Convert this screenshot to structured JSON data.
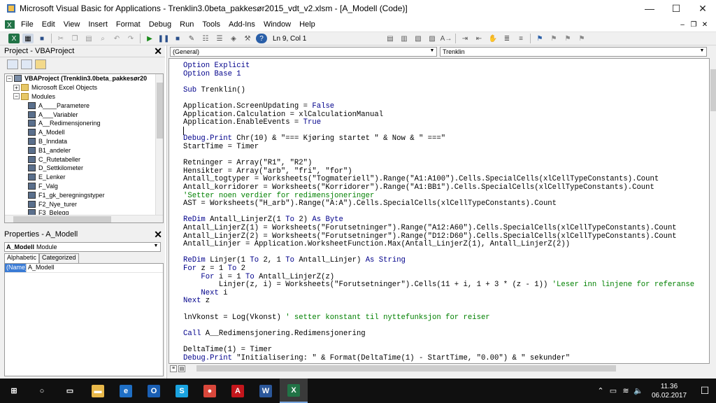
{
  "window": {
    "title": "Microsoft Visual Basic for Applications - Trenklin3.0beta_pakkesør2015_vdt_v2.xlsm - [A_Modell (Code)]",
    "minimize": "—",
    "maximize": "☐",
    "close": "✕"
  },
  "menu": [
    "File",
    "Edit",
    "View",
    "Insert",
    "Format",
    "Debug",
    "Run",
    "Tools",
    "Add-Ins",
    "Window",
    "Help"
  ],
  "mdi": [
    "–",
    "❐",
    "✕"
  ],
  "toolbar": {
    "position": "Ln 9, Col 1"
  },
  "project": {
    "title": "Project - VBAProject",
    "close": "✕",
    "tree": [
      {
        "label": "VBAProject (Trenklin3.0beta_pakkesør20",
        "level": 0,
        "icon": "proj",
        "exp": "−",
        "bold": true
      },
      {
        "label": "Microsoft Excel Objects",
        "level": 1,
        "icon": "folder",
        "exp": "+"
      },
      {
        "label": "Modules",
        "level": 1,
        "icon": "folder",
        "exp": "−"
      },
      {
        "label": "A____Parametere",
        "level": 2,
        "icon": "module"
      },
      {
        "label": "A___Variabler",
        "level": 2,
        "icon": "module"
      },
      {
        "label": "A__Redimensjonering",
        "level": 2,
        "icon": "module"
      },
      {
        "label": "A_Modell",
        "level": 2,
        "icon": "module"
      },
      {
        "label": "B_Inndata",
        "level": 2,
        "icon": "module"
      },
      {
        "label": "B1_andeler",
        "level": 2,
        "icon": "module"
      },
      {
        "label": "C_Rutetabeller",
        "level": 2,
        "icon": "module"
      },
      {
        "label": "D_Settkilometer",
        "level": 2,
        "icon": "module"
      },
      {
        "label": "E_Lenker",
        "level": 2,
        "icon": "module"
      },
      {
        "label": "F_Valg",
        "level": 2,
        "icon": "module"
      },
      {
        "label": "F1_gk_beregningstyper",
        "level": 2,
        "icon": "module"
      },
      {
        "label": "F2_Nye_turer",
        "level": 2,
        "icon": "module"
      },
      {
        "label": "F3_Belegg",
        "level": 2,
        "icon": "module"
      }
    ]
  },
  "properties": {
    "title": "Properties - A_Modell",
    "close": "✕",
    "object_name": "A_Modell",
    "object_type": "Module",
    "tabs": [
      "Alphabetic",
      "Categorized"
    ],
    "rows": [
      {
        "name": "(Name)",
        "value": "A_Modell"
      }
    ]
  },
  "code": {
    "object_combo": "(General)",
    "proc_combo": "Trenklin",
    "lines": [
      [
        [
          "kw",
          "Option Explicit"
        ]
      ],
      [
        [
          "kw",
          "Option Base 1"
        ]
      ],
      [],
      [
        [
          "kw",
          "Sub "
        ],
        [
          "tx",
          "Trenklin()"
        ]
      ],
      [],
      [
        [
          "tx",
          "Application.ScreenUpdating = "
        ],
        [
          "kw",
          "False"
        ]
      ],
      [
        [
          "tx",
          "Application.Calculation = xlCalculationManual"
        ]
      ],
      [
        [
          "tx",
          "Application.EnableEvents = "
        ],
        [
          "kw",
          "True"
        ]
      ],
      [],
      [
        [
          "kw",
          "Debug.Print "
        ],
        [
          "tx",
          "Chr(10) & \"=== Kjøring startet \" & Now & \" ===\""
        ]
      ],
      [
        [
          "tx",
          "StartTime = Timer"
        ]
      ],
      [],
      [
        [
          "tx",
          "Retninger = Array(\"R1\", \"R2\")"
        ]
      ],
      [
        [
          "tx",
          "Hensikter = Array(\"arb\", \"fri\", \"for\")"
        ]
      ],
      [
        [
          "tx",
          "Antall_togtyper = Worksheets(\"Togmateriell\").Range(\"A1:A100\").Cells.SpecialCells(xlCellTypeConstants).Count"
        ]
      ],
      [
        [
          "tx",
          "Antall_korridorer = Worksheets(\"Korridorer\").Range(\"A1:BB1\").Cells.SpecialCells(xlCellTypeConstants).Count"
        ]
      ],
      [
        [
          "cm",
          "'Setter noen verdier for redimensjoneringer"
        ]
      ],
      [
        [
          "tx",
          "AST = Worksheets(\"H_arb\").Range(\"A:A\").Cells.SpecialCells(xlCellTypeConstants).Count"
        ]
      ],
      [],
      [
        [
          "kw",
          "ReDim "
        ],
        [
          "tx",
          "Antall_LinjerZ(1 "
        ],
        [
          "kw",
          "To "
        ],
        [
          "tx",
          "2) "
        ],
        [
          "kw",
          "As Byte"
        ]
      ],
      [
        [
          "tx",
          "Antall_LinjerZ(1) = Worksheets(\"Forutsetninger\").Range(\"A12:A60\").Cells.SpecialCells(xlCellTypeConstants).Count"
        ]
      ],
      [
        [
          "tx",
          "Antall_LinjerZ(2) = Worksheets(\"Forutsetninger\").Range(\"D12:D60\").Cells.SpecialCells(xlCellTypeConstants).Count"
        ]
      ],
      [
        [
          "tx",
          "Antall_Linjer = Application.WorksheetFunction.Max(Antall_LinjerZ(1), Antall_LinjerZ(2))"
        ]
      ],
      [],
      [
        [
          "kw",
          "ReDim "
        ],
        [
          "tx",
          "Linjer(1 "
        ],
        [
          "kw",
          "To "
        ],
        [
          "tx",
          "2, 1 "
        ],
        [
          "kw",
          "To "
        ],
        [
          "tx",
          "Antall_Linjer) "
        ],
        [
          "kw",
          "As String"
        ]
      ],
      [
        [
          "kw",
          "For "
        ],
        [
          "tx",
          "z = 1 "
        ],
        [
          "kw",
          "To "
        ],
        [
          "tx",
          "2"
        ]
      ],
      [
        [
          "kw",
          "    For "
        ],
        [
          "tx",
          "i = 1 "
        ],
        [
          "kw",
          "To "
        ],
        [
          "tx",
          "Antall_LinjerZ(z)"
        ]
      ],
      [
        [
          "tx",
          "        Linjer(z, i) = Worksheets(\"Forutsetninger\").Cells(11 + i, 1 + 3 * (z - 1)) "
        ],
        [
          "cm",
          "'Leser inn linjene for referanse"
        ]
      ],
      [
        [
          "kw",
          "    Next "
        ],
        [
          "tx",
          "i"
        ]
      ],
      [
        [
          "kw",
          "Next "
        ],
        [
          "tx",
          "z"
        ]
      ],
      [],
      [
        [
          "tx",
          "lnVkonst = Log(Vkonst) "
        ],
        [
          "cm",
          "' setter konstant til nyttefunksjon for reiser"
        ]
      ],
      [],
      [
        [
          "kw",
          "Call "
        ],
        [
          "tx",
          "A__Redimensjonering.Redimensjonering"
        ]
      ],
      [],
      [
        [
          "tx",
          "DeltaTime(1) = Timer"
        ]
      ],
      [
        [
          "kw",
          "Debug.Print "
        ],
        [
          "tx",
          "\"Initialisering: \" & Format(DeltaTime(1) - StartTime, \"0.00\") & \" sekunder\""
        ]
      ]
    ]
  },
  "taskbar": {
    "apps": [
      {
        "name": "start",
        "glyph": "⊞",
        "color": "transparent"
      },
      {
        "name": "search",
        "glyph": "○",
        "color": "transparent"
      },
      {
        "name": "task-view",
        "glyph": "▭",
        "color": "transparent"
      },
      {
        "name": "file-explorer",
        "glyph": "▬",
        "color": "#e8b84a"
      },
      {
        "name": "edge",
        "glyph": "e",
        "color": "#1f6fc5"
      },
      {
        "name": "outlook",
        "glyph": "O",
        "color": "#1a5fb4"
      },
      {
        "name": "skype",
        "glyph": "S",
        "color": "#1aa3e0"
      },
      {
        "name": "chrome",
        "glyph": "●",
        "color": "#d9473b"
      },
      {
        "name": "acrobat",
        "glyph": "A",
        "color": "#c4161c"
      },
      {
        "name": "word",
        "glyph": "W",
        "color": "#2b579a"
      },
      {
        "name": "excel",
        "glyph": "X",
        "color": "#217346"
      }
    ],
    "tray": [
      "⌃",
      "▭",
      "≋",
      "🔈"
    ],
    "time": "11.36",
    "date": "06.02.2017",
    "notifications": "☐"
  }
}
